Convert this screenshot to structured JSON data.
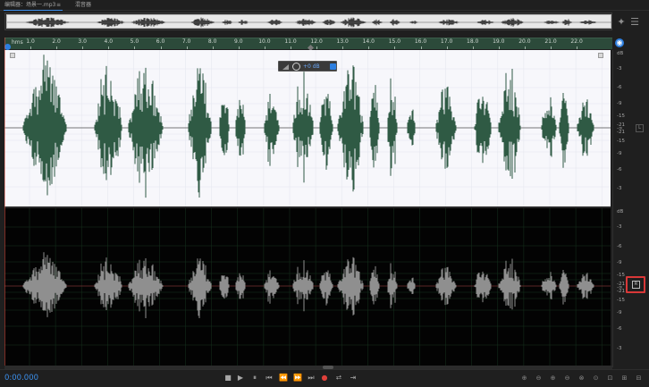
{
  "tabs": {
    "editor": "编辑器：场景一.mp3",
    "editor_menu": "≡",
    "mixer": "混音器"
  },
  "ruler": {
    "unit": "hms",
    "labels": [
      "1.0",
      "2.0",
      "3.0",
      "4.0",
      "5.0",
      "6.0",
      "7.0",
      "8.0",
      "9.0",
      "10.0",
      "11.0",
      "12.0",
      "13.0",
      "14.0",
      "15.0",
      "16.0",
      "17.0",
      "18.0",
      "19.0",
      "20.0",
      "21.0",
      "22.0"
    ]
  },
  "hud": {
    "value": "+0 dB"
  },
  "db_scale": {
    "unit": "dB",
    "ch1_top": [
      "-3",
      "-6",
      "-9",
      "-15",
      "-21",
      "-∞",
      "-21",
      "-15",
      "-9",
      "-6",
      "-3"
    ],
    "ch1_badge": "L",
    "ch2_top": [
      "-3",
      "-6",
      "-9",
      "-15",
      "-21",
      "-∞",
      "-21",
      "-15",
      "-9",
      "-6",
      "-3"
    ],
    "ch2_badge": "R"
  },
  "transport": {
    "time": "0:00.000",
    "stop": "■",
    "play": "▶",
    "pause": "⏸",
    "to_start": "⏮",
    "rewind": "⏪",
    "forward": "⏩",
    "to_end": "⏭",
    "record": "●",
    "loop": "⮂",
    "skip": "⇥"
  },
  "colors": {
    "ch1_wave": "#2f5a44",
    "ch2_wave": "#8f8f8f",
    "accent": "#3b8eea",
    "ruler_bg": "#2c4a3a",
    "highlight": "#d93838"
  }
}
